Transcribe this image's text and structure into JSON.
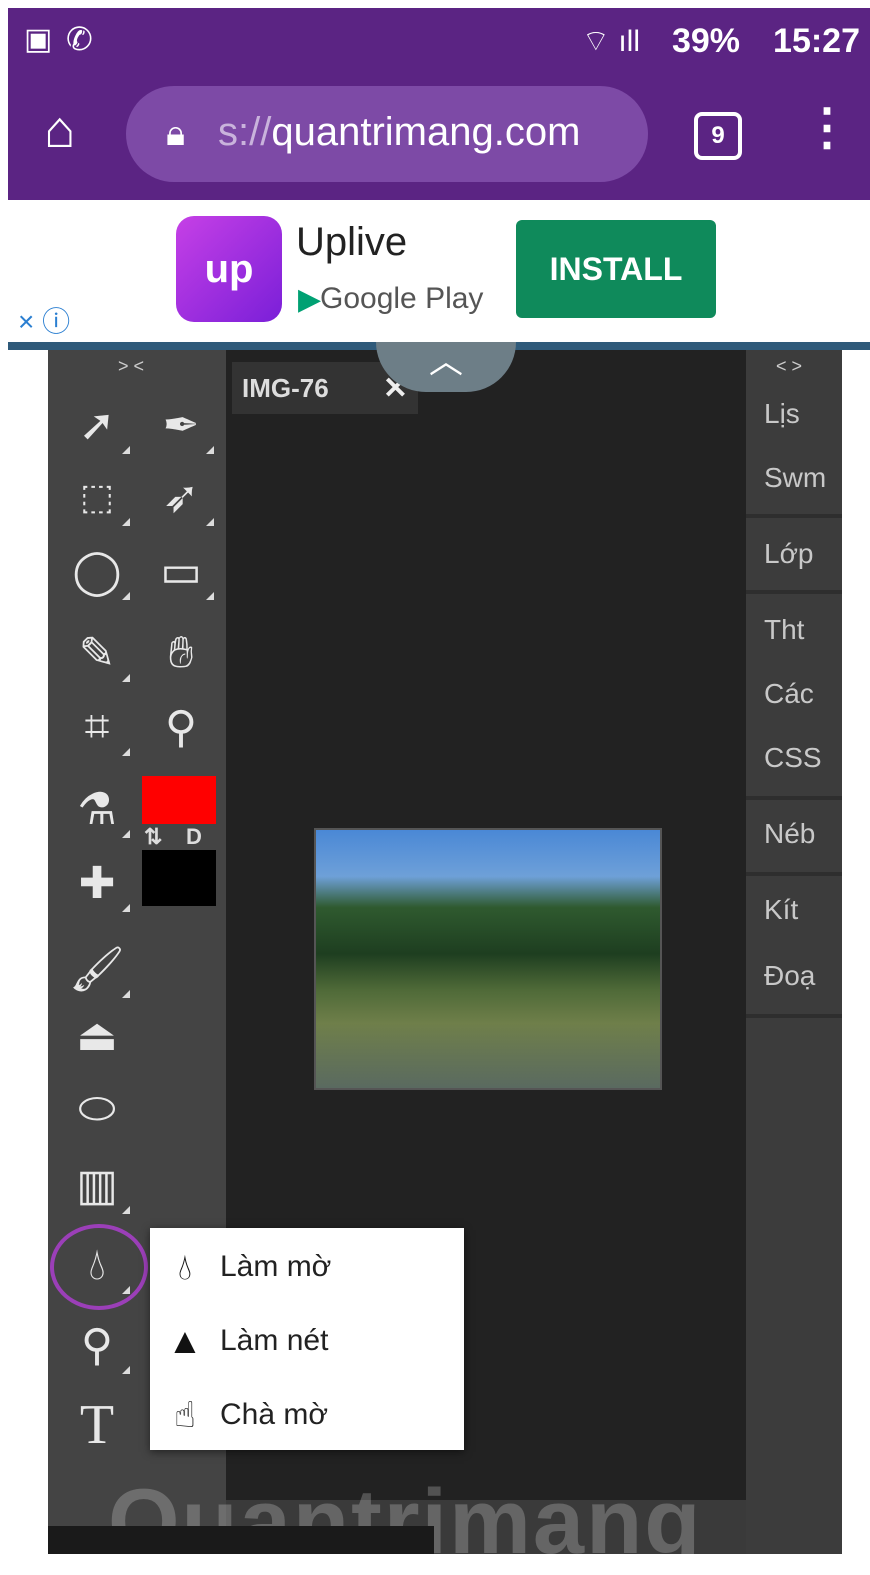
{
  "status": {
    "battery": "39%",
    "time": "15:27"
  },
  "browser": {
    "url_prefix": "s://",
    "url_host": "quantrimang.com",
    "tabs": "9"
  },
  "ad": {
    "logo": "up",
    "title": "Uplive",
    "store": "Google Play",
    "install": "INSTALL",
    "close": "× ⓘ"
  },
  "editor": {
    "doc_tab": "IMG-76",
    "left_header": "> <",
    "right_header": "< >",
    "swap": "⇅",
    "default": "D",
    "right_panel": [
      "Lịs",
      "Swm",
      "Lớp",
      "Tht",
      "Các",
      "CSS",
      "Néb",
      "Kít",
      "Đoạ"
    ],
    "watermark": "Quantrimang",
    "menu": [
      {
        "icon": "blur-drop-icon",
        "label": "Làm mờ"
      },
      {
        "icon": "sharpen-triangle-icon",
        "label": "Làm nét"
      },
      {
        "icon": "smudge-finger-icon",
        "label": "Chà mờ"
      }
    ],
    "colors": {
      "foreground": "#ff0000",
      "background": "#000000",
      "highlight": "#9b3fb8"
    }
  }
}
